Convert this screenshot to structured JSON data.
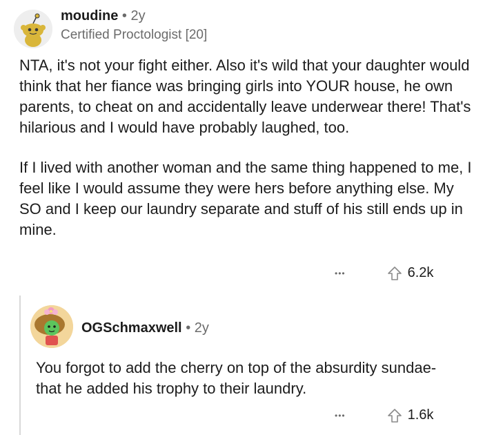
{
  "comments": [
    {
      "username": "moudine",
      "separator": "•",
      "age": "2y",
      "flair": "Certified Proctologist [20]",
      "paragraphs": [
        "NTA, it's not your fight either. Also it's wild that your daughter would think that her fiance was bringing girls into YOUR house, he own parents, to cheat on and accidentally leave underwear there! That's hilarious and I would have probably laughed, too.",
        "If I lived with another woman and the same thing happened to me, I feel like I would assume they were hers before anything else. My SO and I keep our laundry separate and stuff of his still ends up in mine."
      ],
      "more_label": "•••",
      "votes": "6.2k"
    },
    {
      "username": "OGSchmaxwell",
      "separator": "•",
      "age": "2y",
      "paragraphs": [
        "You forgot to add the cherry on top of the absurdity sundae- that he added his trophy to their laundry."
      ],
      "more_label": "•••",
      "votes": "1.6k"
    }
  ],
  "icons": {
    "upvote": "upvote-arrow-icon",
    "more": "more-options-icon",
    "avatar1": "snoo-avatar-icon",
    "avatar2": "character-avatar-icon"
  },
  "colors": {
    "avatar1": "#d9b63a",
    "avatar2": "#f3d69b"
  }
}
